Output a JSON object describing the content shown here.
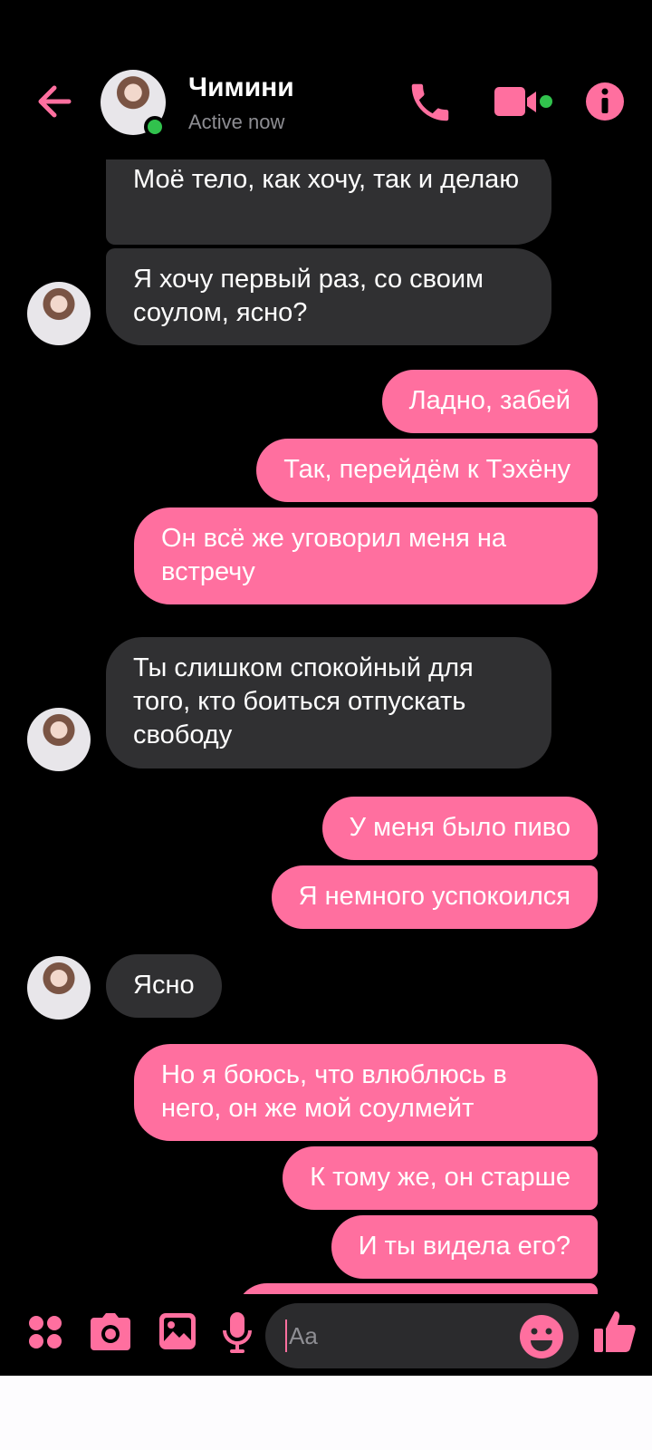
{
  "header": {
    "contact_name": "Чимини",
    "status": "Active now",
    "icons": [
      "back-arrow-icon",
      "phone-icon",
      "video-camera-icon",
      "info-icon"
    ]
  },
  "messages": [
    {
      "side": "in",
      "text": "Моё тело, как хочу, так и делаю"
    },
    {
      "side": "in",
      "text": "Я хочу первый раз, со своим соулом, ясно?"
    },
    {
      "side": "out",
      "text": "Ладно, забей"
    },
    {
      "side": "out",
      "text": "Так, перейдём к Тэхёну"
    },
    {
      "side": "out",
      "text": "Он всё же уговорил меня на встречу"
    },
    {
      "side": "in",
      "text": "Ты слишком спокойный для того, кто боиться отпускать свободу"
    },
    {
      "side": "out",
      "text": "У меня было пиво"
    },
    {
      "side": "out",
      "text": "Я немного успокоился"
    },
    {
      "side": "in",
      "text": "Ясно"
    },
    {
      "side": "out",
      "text": "Но я боюсь, что влюблюсь в него, он же мой соулмейт"
    },
    {
      "side": "out",
      "text": "К тому же, он старше"
    },
    {
      "side": "out",
      "text": "И ты видела его?"
    }
  ],
  "composer": {
    "placeholder": "Aa",
    "icons": [
      "apps-icon",
      "camera-icon",
      "gallery-icon",
      "microphone-icon",
      "emoji-icon",
      "thumbs-up-icon"
    ]
  },
  "colors": {
    "accent": "#ff6f9f",
    "incoming_bubble": "#303032",
    "background": "#000000",
    "online": "#31c24d"
  }
}
